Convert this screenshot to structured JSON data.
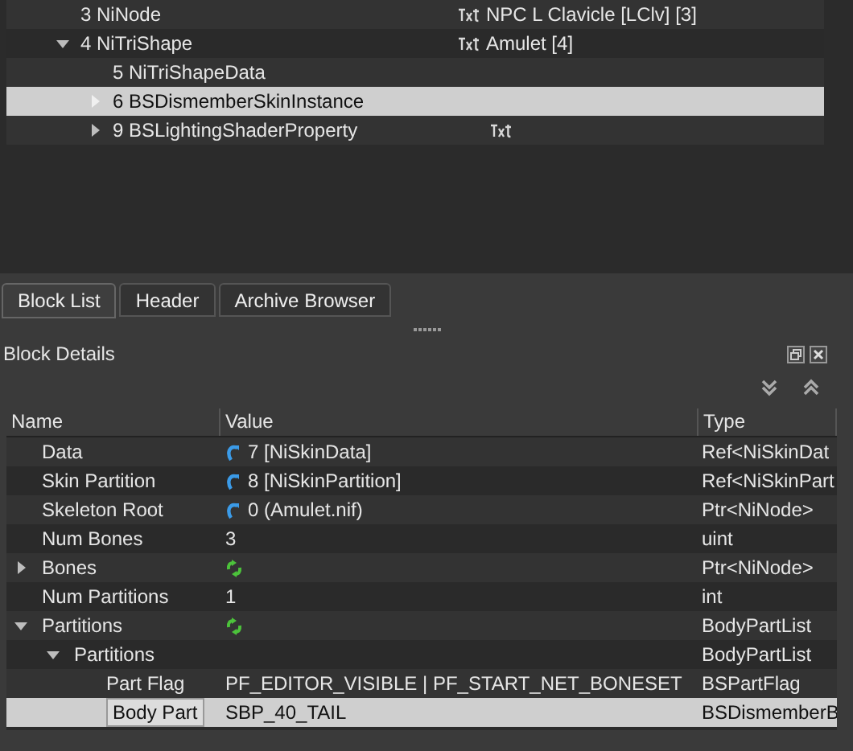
{
  "block_tree": {
    "items": [
      {
        "label": "3 NiNode",
        "value": "NPC L Clavicle [LClv] [3]",
        "text_icon": true,
        "selected": false
      },
      {
        "label": "4 NiTriShape",
        "value": "Amulet [4]",
        "text_icon": true,
        "expanded": true,
        "selected": false,
        "children": [
          {
            "label": "5 NiTriShapeData",
            "selected": false
          },
          {
            "label": "6 BSDismemberSkinInstance",
            "expanded": false,
            "selected": true
          },
          {
            "label": "9 BSLightingShaderProperty",
            "text_icon": true,
            "expanded": false,
            "selected": false
          }
        ]
      }
    ]
  },
  "tabs": [
    {
      "label": "Block List",
      "selected": true
    },
    {
      "label": "Header",
      "selected": false
    },
    {
      "label": "Archive Browser",
      "selected": false
    }
  ],
  "block_details": {
    "title": "Block Details",
    "columns": [
      "Name",
      "Value",
      "Type"
    ],
    "rows": [
      {
        "name": "Data",
        "value": "7 [NiSkinData]",
        "link_icon": true,
        "type": "Ref<NiSkinDat",
        "selected": false
      },
      {
        "name": "Skin Partition",
        "value": "8 [NiSkinPartition]",
        "link_icon": true,
        "type": "Ref<NiSkinPart",
        "selected": false
      },
      {
        "name": "Skeleton Root",
        "value": "0 (Amulet.nif)",
        "link_icon": true,
        "type": "Ptr<NiNode>",
        "selected": false
      },
      {
        "name": "Num Bones",
        "value": "3",
        "type": "uint",
        "selected": false
      },
      {
        "name": "Bones",
        "array_icon": true,
        "type": "Ptr<NiNode>",
        "expanded": false,
        "selected": false
      },
      {
        "name": "Num Partitions",
        "value": "1",
        "type": "int",
        "selected": false
      },
      {
        "name": "Partitions",
        "array_icon": true,
        "type": "BodyPartList",
        "expanded": true,
        "selected": false,
        "children": [
          {
            "name": "Partitions",
            "type": "BodyPartList",
            "expanded": true,
            "selected": false,
            "children": [
              {
                "name": "Part Flag",
                "value": "PF_EDITOR_VISIBLE | PF_START_NET_BONESET",
                "type": "BSPartFlag",
                "selected": false
              },
              {
                "name": "Body Part",
                "value": "SBP_40_TAIL",
                "type": "BSDismemberB",
                "selected": true
              }
            ]
          }
        ]
      }
    ]
  }
}
